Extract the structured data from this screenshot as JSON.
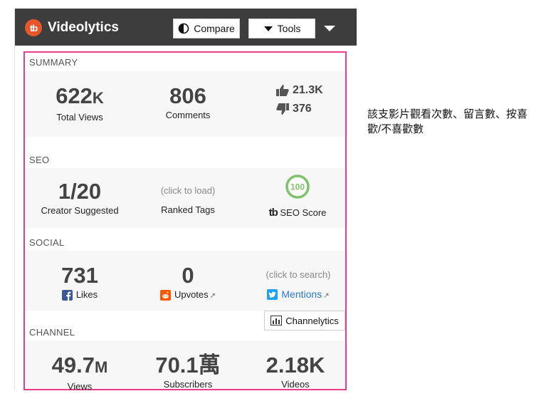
{
  "header": {
    "brand": "Videolytics",
    "brand_logo": "tb",
    "compare_label": "Compare",
    "tools_label": "Tools"
  },
  "summary": {
    "title": "SUMMARY",
    "total_views_value": "622",
    "total_views_unit": "K",
    "total_views_label": "Total Views",
    "comments_value": "806",
    "comments_label": "Comments",
    "likes_value": "21.3K",
    "dislikes_value": "376"
  },
  "seo": {
    "title": "SEO",
    "creator_suggested_value": "1/20",
    "creator_suggested_label": "Creator Suggested",
    "ranked_tags_value": "(click to load)",
    "ranked_tags_label": "Ranked Tags",
    "seo_score_value": "100",
    "seo_score_label": "SEO Score"
  },
  "social": {
    "title": "SOCIAL",
    "likes_value": "731",
    "likes_label": "Likes",
    "upvotes_value": "0",
    "upvotes_label": "Upvotes",
    "mentions_value": "(click to search)",
    "mentions_label": "Mentions"
  },
  "channel": {
    "title": "CHANNEL",
    "channelytics_label": "Channelytics",
    "views_value": "49.7",
    "views_unit": "M",
    "views_label": "Views",
    "subscribers_value": "70.1萬",
    "subscribers_label": "Subscribers",
    "videos_value": "2.18K",
    "videos_label": "Videos"
  },
  "annotation": "該支影片觀看次數、留言數、按喜歡/不喜歡數",
  "colors": {
    "topbar": "#3d3d3d",
    "brand_orange": "#e8572c",
    "highlight_border": "#e83e8c",
    "link_blue": "#2a7ad3",
    "seo_green": "#7dc36a",
    "facebook_blue": "#3b5998",
    "reddit_orange": "#ff5700",
    "twitter_blue": "#1da1f2"
  }
}
